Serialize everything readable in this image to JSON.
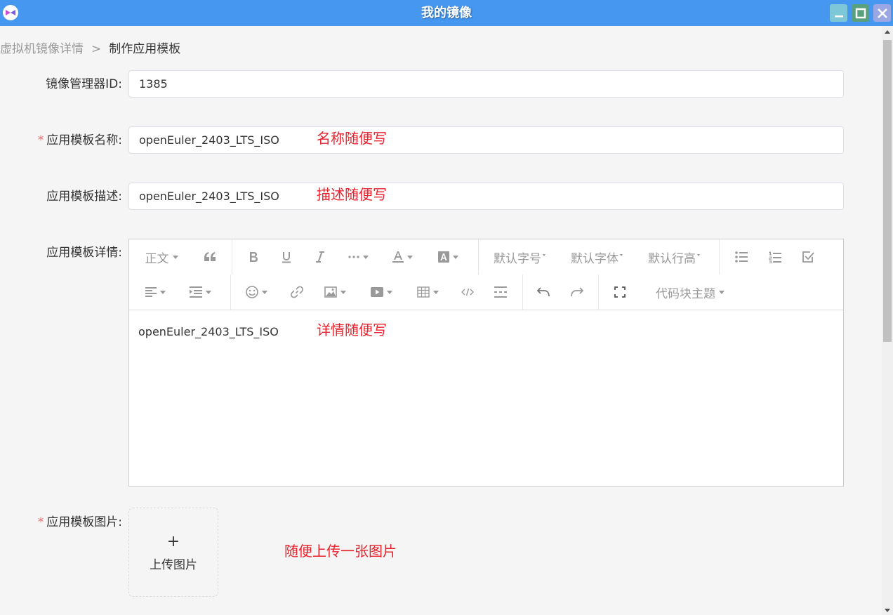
{
  "window": {
    "title": "我的镜像",
    "controls": [
      "minimize",
      "maximize",
      "close"
    ]
  },
  "breadcrumb": {
    "parent": "虚拟机镜像详情",
    "separator": ">",
    "current": "制作应用模板"
  },
  "form": {
    "manager_id": {
      "label": "镜像管理器ID:",
      "value": "1385"
    },
    "template_name": {
      "required_mark": "*",
      "label": "应用模板名称:",
      "value": "openEuler_2403_LTS_ISO",
      "annotation": "名称随便写"
    },
    "template_desc": {
      "label": "应用模板描述:",
      "value": "openEuler_2403_LTS_ISO",
      "annotation": "描述随便写"
    },
    "template_detail": {
      "label": "应用模板详情:",
      "value": "openEuler_2403_LTS_ISO",
      "annotation": "详情随便写",
      "toolbar": {
        "paragraph": "正文",
        "font_size": "默认字号",
        "font_family": "默认字体",
        "line_height": "默认行高",
        "code_theme": "代码块主题",
        "icons": [
          "quote-icon",
          "bold-icon",
          "underline-icon",
          "italic-icon",
          "more-icon",
          "font-color-icon",
          "bg-color-icon",
          "bullet-list-icon",
          "numbered-list-icon",
          "todo-icon",
          "align-icon",
          "indent-icon",
          "emoji-icon",
          "link-icon",
          "image-icon",
          "video-icon",
          "table-icon",
          "code-icon",
          "divider-icon",
          "undo-icon",
          "redo-icon",
          "fullscreen-icon"
        ]
      }
    },
    "template_image": {
      "required_mark": "*",
      "label": "应用模板图片:",
      "upload_plus": "+",
      "upload_text": "上传图片",
      "annotation": "随便上传一张图片"
    }
  },
  "colors": {
    "titlebar": "#4597f0",
    "annotation": "#e8212c",
    "required": "#f56c6c"
  }
}
